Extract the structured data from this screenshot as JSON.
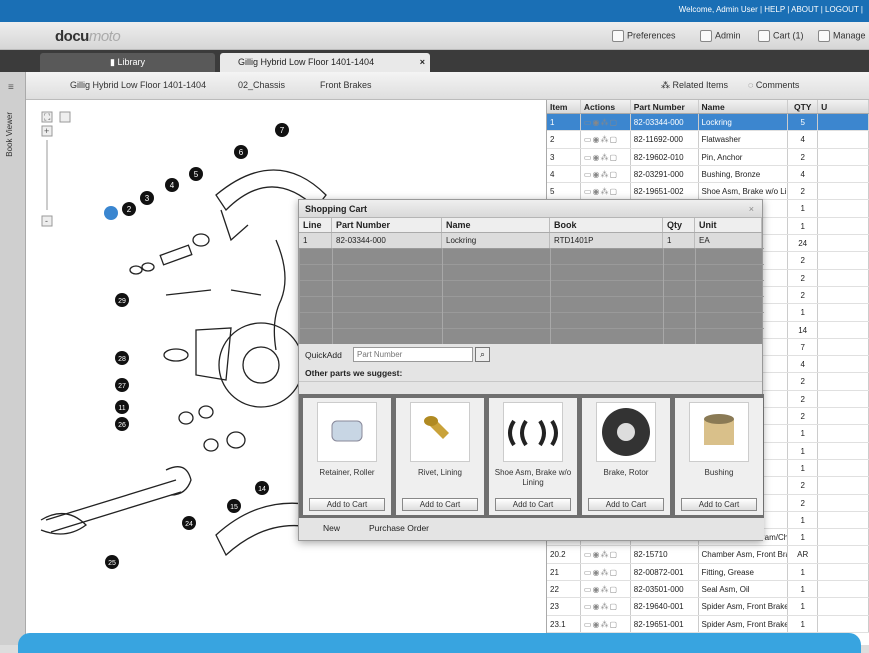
{
  "topbar": {
    "links": "Welcome, Admin User | HELP | ABOUT | LOGOUT |"
  },
  "logo": {
    "main": "docu",
    "sub": "moto"
  },
  "header": {
    "preferences": "Preferences",
    "admin": "Admin",
    "cart": "Cart (1)",
    "manage": "Manage"
  },
  "tabs": {
    "library": "Library",
    "book": "Gillig Hybrid Low Floor 1401-1404",
    "close": "×"
  },
  "sidebar": {
    "label": "Book Viewer"
  },
  "breadcrumb": {
    "book": "Gillig Hybrid Low Floor 1401-1404",
    "chapter": "02_Chassis",
    "page": "Front Brakes"
  },
  "actions": {
    "related": "Related Items",
    "comments": "Comments"
  },
  "table": {
    "headers": [
      "Item",
      "Actions",
      "Part Number",
      "Name",
      "QTY",
      "U"
    ],
    "rows": [
      {
        "item": "1",
        "part": "82-03344-000",
        "name": "Lockring",
        "qty": "5"
      },
      {
        "item": "2",
        "part": "82-11692-000",
        "name": "Flatwasher",
        "qty": "4"
      },
      {
        "item": "3",
        "part": "82-19602-010",
        "name": "Pin, Anchor",
        "qty": "2"
      },
      {
        "item": "4",
        "part": "82-03291-000",
        "name": "Bushing, Bronze",
        "qty": "4"
      },
      {
        "item": "5",
        "part": "82-19651-002",
        "name": "Shoe Asm, Brake w/o Lini",
        "qty": "2"
      },
      {
        "item": "",
        "part": "",
        "name": "w/Lining &",
        "qty": "1"
      },
      {
        "item": "",
        "part": "",
        "name": "w/Lining &",
        "qty": "1"
      },
      {
        "item": "",
        "part": "",
        "name": "",
        "qty": "24"
      },
      {
        "item": "",
        "part": "",
        "name": "ing",
        "qty": "2"
      },
      {
        "item": "",
        "part": "",
        "name": "hoe",
        "qty": "2"
      },
      {
        "item": "",
        "part": "",
        "name": "",
        "qty": "2"
      },
      {
        "item": "",
        "part": "",
        "name": "",
        "qty": "1"
      },
      {
        "item": "",
        "part": "",
        "name": "ned",
        "qty": "14"
      },
      {
        "item": "",
        "part": "",
        "name": "",
        "qty": "7"
      },
      {
        "item": "",
        "part": "",
        "name": "",
        "qty": "4"
      },
      {
        "item": "",
        "part": "",
        "name": "n",
        "qty": "2"
      },
      {
        "item": "",
        "part": "",
        "name": "",
        "qty": "2"
      },
      {
        "item": "",
        "part": "",
        "name": "sm",
        "qty": "2"
      },
      {
        "item": "",
        "part": "",
        "name": "",
        "qty": "1"
      },
      {
        "item": "",
        "part": "",
        "name": "k Adjuster,",
        "qty": "1"
      },
      {
        "item": "",
        "part": "",
        "name": "k Adjuster,",
        "qty": "1"
      },
      {
        "item": "",
        "part": "",
        "name": "ck",
        "qty": "2"
      },
      {
        "item": "",
        "part": "",
        "name": "r",
        "qty": "2"
      },
      {
        "item": "",
        "part": "",
        "name": "-Cam/Cha",
        "qty": "1"
      },
      {
        "item": "20.1",
        "part": "82-19651-004",
        "name": "Bracket Asm, S-Cam/Cha",
        "qty": "1"
      },
      {
        "item": "20.2",
        "part": "82-15710",
        "name": "Chamber Asm, Front Brak",
        "qty": "AR"
      },
      {
        "item": "21",
        "part": "82-00872-001",
        "name": "Fitting, Grease",
        "qty": "1"
      },
      {
        "item": "22",
        "part": "82-03501-000",
        "name": "Seal Asm, Oil",
        "qty": "1"
      },
      {
        "item": "23",
        "part": "82-19640-001",
        "name": "Spider Asm, Front Brake,",
        "qty": "1"
      },
      {
        "item": "23.1",
        "part": "82-19651-001",
        "name": "Spider Asm, Front Brake",
        "qty": "1"
      }
    ]
  },
  "cart": {
    "title": "Shopping Cart",
    "close": "×",
    "headers": [
      "Line",
      "Part Number",
      "Name",
      "Book",
      "Qty",
      "Unit"
    ],
    "row": {
      "line": "1",
      "part": "82-03344-000",
      "name": "Lockring",
      "book": "RTD1401P",
      "qty": "1",
      "unit": "EA"
    },
    "quickadd_label": "QuickAdd",
    "quickadd_placeholder": "Part Number",
    "suggest_title": "Other parts we suggest:",
    "suggestions": [
      {
        "name": "Retainer, Roller",
        "button": "Add to Cart"
      },
      {
        "name": "Rivet, Lining",
        "button": "Add to Cart"
      },
      {
        "name": "Shoe Asm, Brake w/o Lining",
        "button": "Add to Cart"
      },
      {
        "name": "Brake, Rotor",
        "button": "Add to Cart"
      },
      {
        "name": "Bushing",
        "button": "Add to Cart"
      }
    ],
    "new": "New",
    "purchase": "Purchase Order"
  },
  "callouts": [
    "1",
    "2",
    "3",
    "4",
    "5",
    "6",
    "7",
    "29",
    "28",
    "27",
    "11",
    "26",
    "24",
    "15",
    "14",
    "25"
  ]
}
